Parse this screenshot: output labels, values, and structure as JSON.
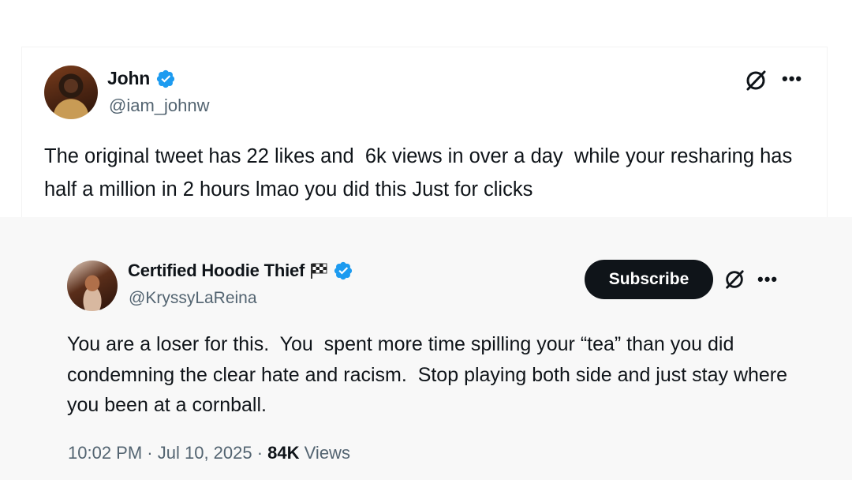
{
  "reply_tweet": {
    "author_name": "John",
    "author_handle": "@iam_johnw",
    "text": "The original tweet has 22 likes and  6k views in over a day  while your resharing has half a million in 2 hours lmao you did this Just for clicks"
  },
  "quoted_tweet": {
    "author_name": "Certified Hoodie Thief",
    "author_handle": "@KryssyLaReina",
    "subscribe_label": "Subscribe",
    "text": "You are a loser for this.  You  spent more time spilling your “tea” than you did condemning the clear hate and racism.  Stop playing both side and just stay where you been at a cornball.",
    "time": "10:02 PM",
    "date": "Jul 10, 2025",
    "views_count": "84K",
    "views_label": "Views"
  },
  "icons": {
    "verified": "verified-badge-icon",
    "grok": "grok-icon",
    "more": "more-options-icon",
    "flag": "checkered-flag-icon"
  },
  "colors": {
    "verified_blue": "#1d9bf0",
    "text_primary": "#0f1419",
    "text_secondary": "#536471",
    "button_bg": "#0f1419"
  }
}
